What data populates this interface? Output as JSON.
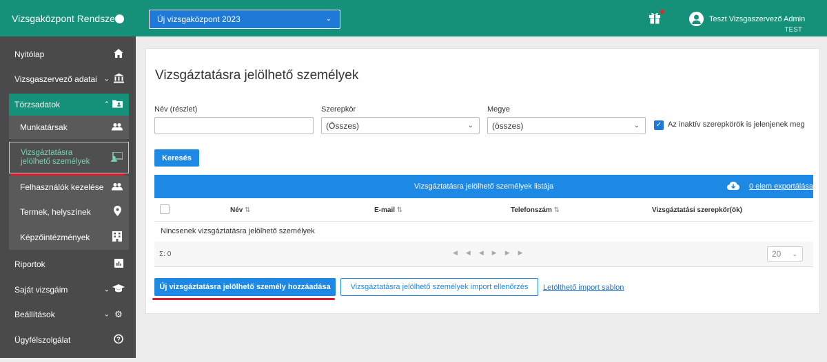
{
  "sidebar": {
    "app_title": "Vizsgaközpont Rendszer",
    "items": [
      {
        "label": "Nyitólap",
        "icon": "home-icon"
      },
      {
        "label": "Vizsgaszervező adatai",
        "icon": "bank-icon"
      },
      {
        "label": "Törzsadatok",
        "icon": "folder-user-icon"
      },
      {
        "label": "Munkatársak",
        "icon": "people-icon"
      },
      {
        "label": "Vizsgáztatásra jelölhető személyek",
        "icon": "monitor-user-icon"
      },
      {
        "label": "Felhasználók kezelése",
        "icon": "people-icon"
      },
      {
        "label": "Termek, helyszínek",
        "icon": "location-pin-icon"
      },
      {
        "label": "Képzőintézmények",
        "icon": "building-icon"
      },
      {
        "label": "Riportok",
        "icon": "chart-icon"
      },
      {
        "label": "Saját vizsgáim",
        "icon": "graduation-cap-icon"
      },
      {
        "label": "Beállítások",
        "icon": "gear-icon"
      },
      {
        "label": "Ügyfélszolgálat",
        "icon": "help-icon"
      }
    ]
  },
  "topbar": {
    "center_select": "Új vizsgaközpont 2023",
    "user_name": "Teszt Vizsgaszervező Admin",
    "user_org": "TEST"
  },
  "main": {
    "title": "Vizsgáztatásra jelölhető személyek",
    "filters": {
      "name_label": "Név (részlet)",
      "name_value": "",
      "role_label": "Szerepkör",
      "role_value": "(Összes)",
      "county_label": "Megye",
      "county_value": "(összes)",
      "inactive_label": "Az inaktív szerepkörök is jelenjenek meg"
    },
    "search_button": "Keresés",
    "table": {
      "title": "Vizsgáztatásra jelölhető személyek listája",
      "export_label": "0 elem exportálása",
      "columns": [
        "Név",
        "E-mail",
        "Telefonszám",
        "Vizsgáztatási szerepkör(ök)"
      ],
      "empty_text": "Nincsenek vizsgáztatásra jelölhető személyek",
      "sum_label": "Σ: 0",
      "page_size": "20"
    },
    "add_button": "Új vizsgáztatásra jelölhető személy hozzáadása",
    "import_button": "Vizsgáztatásra jelölhető személyek import ellenőrzés",
    "template_link": "Letölthető import sablon"
  },
  "colors": {
    "brand_green": "#15917a",
    "primary_blue": "#1e88e5",
    "sidebar_dark": "#4a4a4a",
    "highlight_red": "#e0192b"
  }
}
